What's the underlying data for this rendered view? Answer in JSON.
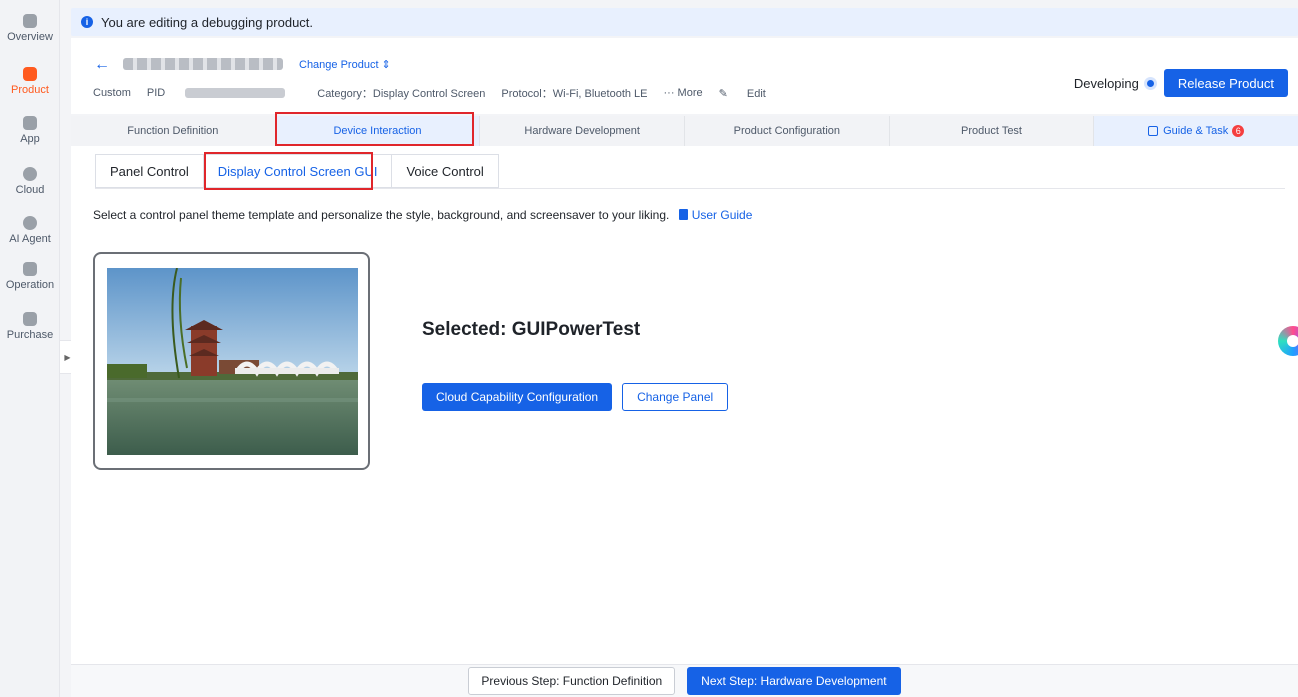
{
  "banner": {
    "text": "You are editing a debugging product."
  },
  "sidebar": {
    "items": [
      {
        "label": "Overview",
        "icon": "home-icon"
      },
      {
        "label": "Product",
        "icon": "product-icon",
        "active": true
      },
      {
        "label": "App",
        "icon": "app-icon"
      },
      {
        "label": "Cloud",
        "icon": "cloud-icon"
      },
      {
        "label": "AI Agent",
        "icon": "ai-agent-icon"
      },
      {
        "label": "Operation",
        "icon": "operation-icon"
      },
      {
        "label": "Purchase",
        "icon": "purchase-icon"
      }
    ]
  },
  "header": {
    "change_product": "Change Product ⇕",
    "custom": "Custom",
    "pid_label": "PID",
    "category": "Category：Display Control Screen",
    "protocol": "Protocol：Wi-Fi, Bluetooth LE",
    "more": "··· More",
    "edit": "Edit",
    "status": "Developing",
    "release_button": "Release Product"
  },
  "steps": [
    {
      "label": "Function Definition"
    },
    {
      "label": "Device Interaction",
      "active": true
    },
    {
      "label": "Hardware Development"
    },
    {
      "label": "Product Configuration"
    },
    {
      "label": "Product Test"
    }
  ],
  "guide": {
    "label": "Guide & Task",
    "badge": "6"
  },
  "subtabs": [
    {
      "label": "Panel Control"
    },
    {
      "label": "Display Control Screen GUI",
      "active": true
    },
    {
      "label": "Voice Control"
    }
  ],
  "description": "Select a control panel theme template and personalize the style, background, and screensaver to your liking.",
  "user_guide": "User Guide",
  "selected_panel": "Selected: GUIPowerTest",
  "buttons": {
    "cloud_config": "Cloud Capability Configuration",
    "change_panel": "Change Panel"
  },
  "footer": {
    "prev": "Previous Step: Function Definition",
    "next": "Next Step: Hardware Development"
  },
  "colors": {
    "accent": "#1662e6",
    "brand": "#ff5a1f",
    "highlight": "#e0262b",
    "badge": "#f53f3f"
  }
}
